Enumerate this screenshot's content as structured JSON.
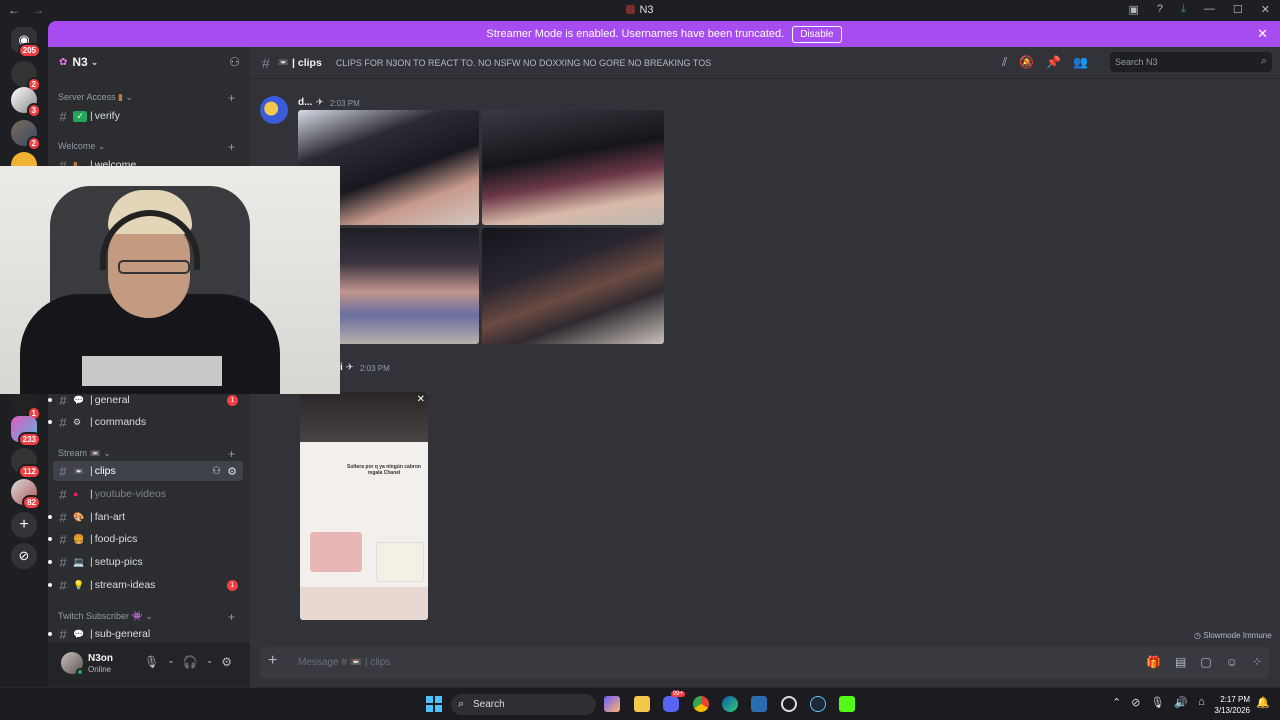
{
  "window": {
    "title": "N3",
    "back": "←",
    "forward": "→"
  },
  "banner": {
    "text": "Streamer Mode is enabled. Usernames have been truncated.",
    "button": "Disable"
  },
  "guilds": [
    {
      "badge": "205"
    },
    {
      "badge": "2"
    },
    {
      "badge": "3"
    },
    {
      "badge": "2"
    },
    {
      "badge": "1"
    },
    {
      "badge": "233"
    },
    {
      "badge": "112"
    },
    {
      "badge": "82"
    }
  ],
  "server": {
    "name": "N3"
  },
  "categories": {
    "server_access": "Server Access",
    "welcome": "Welcome",
    "stream": "Stream",
    "twitch": "Twitch Subscriber"
  },
  "channels": {
    "verify": "verify",
    "welcome": "welcome",
    "general": "general",
    "commands": "commands",
    "clips": "clips",
    "youtube": "youtube-videos",
    "fanart": "fan-art",
    "food": "food-pics",
    "setup": "setup-pics",
    "ideas": "stream-ideas",
    "subgeneral": "sub-general"
  },
  "unread": {
    "general": "1",
    "ideas": "1"
  },
  "header": {
    "channel": "clips",
    "topic": "CLIPS FOR N3ON TO REACT TO. NO NSFW NO DOXXING NO GORE NO BREAKING TOS",
    "search_placeholder": "Search N3"
  },
  "messages": [
    {
      "author": "d...",
      "time": "2:03 PM"
    },
    {
      "author": "i",
      "time": "2:03 PM"
    }
  ],
  "story": {
    "caption": "Soltera por q ya ningún cabron regala Chanel"
  },
  "slowmode": "Slowmode Immune",
  "composer": {
    "placeholder": "Message # 📼 | clips"
  },
  "user": {
    "name": "N3on",
    "status": "Online"
  },
  "taskbar": {
    "search": "Search",
    "time": "2:17 PM",
    "date": "3/13/2026",
    "discord_badge": "99+"
  },
  "colors": {
    "banner": "#a74cf0",
    "unread": "#f23f43",
    "online": "#23a55a"
  }
}
